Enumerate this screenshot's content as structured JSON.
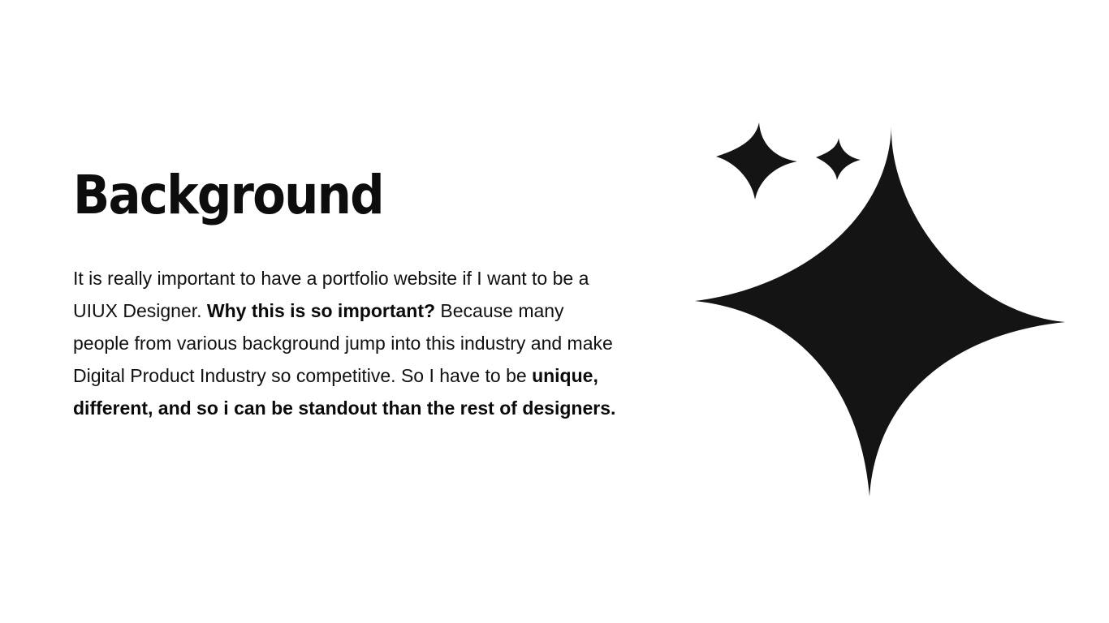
{
  "slide": {
    "title": "Background",
    "paragraph": {
      "part1": "It is really important to have a portfolio website if I want to be a UIUX Designer. ",
      "bold1": "Why this is so important?",
      "part2": " Because many people from various background jump into this industry and make Digital Product Industry so competitive. So I have to be ",
      "bold2": "unique, different, and so i can be standout than the rest of designers."
    }
  },
  "decoration": {
    "icon": "sparkles-icon",
    "color": "#141414"
  }
}
